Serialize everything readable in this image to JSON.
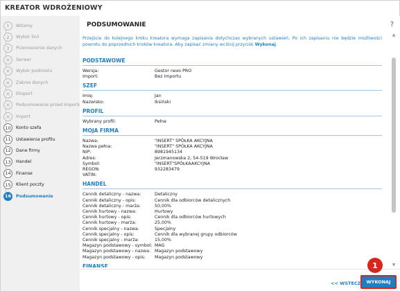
{
  "app": {
    "title": "KREATOR WDROŻENIOWY"
  },
  "steps": [
    {
      "num": "1",
      "label": "Witamy",
      "state": "done"
    },
    {
      "num": "2",
      "label": "Wybór linii",
      "state": "done"
    },
    {
      "num": "3",
      "label": "Przeniesienie danych",
      "state": "done"
    },
    {
      "num": "×",
      "label": "Serwer",
      "state": "skip"
    },
    {
      "num": "×",
      "label": "Wybór podmiotu",
      "state": "skip"
    },
    {
      "num": "×",
      "label": "Zakres danych",
      "state": "skip"
    },
    {
      "num": "×",
      "label": "Eksport",
      "state": "skip"
    },
    {
      "num": "×",
      "label": "Podsumowanie przed importem",
      "state": "skip"
    },
    {
      "num": "×",
      "label": "Import",
      "state": "skip"
    },
    {
      "num": "10",
      "label": "Konto szefa",
      "state": "todo"
    },
    {
      "num": "11",
      "label": "Ustawienia profilu",
      "state": "todo"
    },
    {
      "num": "12",
      "label": "Dane firmy",
      "state": "todo"
    },
    {
      "num": "13",
      "label": "Handel",
      "state": "todo"
    },
    {
      "num": "14",
      "label": "Finanse",
      "state": "todo"
    },
    {
      "num": "15",
      "label": "Klient poczty",
      "state": "todo"
    },
    {
      "num": "16",
      "label": "Podsumowanie",
      "state": "active"
    }
  ],
  "main": {
    "title": "PODSUMOWANIE",
    "help": "?",
    "info_pre": "Przejście do kolejnego kroku kreatora wymaga zapisania dotychczas wybranych ustawień. Po ich zapisaniu nie będzie możliwości powrotu do poprzednich kroków kreatora. Aby zapisać zmiany wciśnij przycisk ",
    "info_bold": "Wykonaj",
    "info_post": ".",
    "sections": [
      {
        "title": "PODSTAWOWE",
        "rows": [
          {
            "k": "Wersja:",
            "v": "Gestor nexo PRO"
          },
          {
            "k": "Import:",
            "v": "Bez importu"
          }
        ]
      },
      {
        "title": "SZEF",
        "rows": [
          {
            "k": "Imię:",
            "v": "Jan"
          },
          {
            "k": "Nazwisko:",
            "v": "Iksiński"
          }
        ]
      },
      {
        "title": "PROFIL",
        "rows": [
          {
            "k": "Wybrany profil:",
            "v": "Pełne"
          }
        ]
      },
      {
        "title": "MOJA FIRMA",
        "rows": [
          {
            "k": "Nazwa:",
            "v": "\"INSERT\" SPÓŁKA AKCYJNA"
          },
          {
            "k": "Nazwa pełna:",
            "v": "\"INSERT\" SPÓŁKA AKCYJNA"
          },
          {
            "k": "NIP:",
            "v": "8981945134"
          },
          {
            "k": "Adres:",
            "v": "Jerzmanowska 2, 54-519 Wrocław"
          },
          {
            "k": "Symbol:",
            "v": "\"INSERT\"SPÓŁKAAKCYJNA"
          },
          {
            "k": "REGON:",
            "v": "932283479"
          },
          {
            "k": "VATIN:",
            "v": ""
          }
        ]
      },
      {
        "title": "HANDEL",
        "rows": [
          {
            "k": "Cennik detaliczny - nazwa:",
            "v": "Detaliczny"
          },
          {
            "k": "Cennik detaliczny - opis:",
            "v": "Cennik dla odbiorców detalicznych"
          },
          {
            "k": "Cennik detaliczny - marża:",
            "v": "50,00%"
          },
          {
            "k": "Cennik hurtowy - nazwa:",
            "v": "Hurtowy"
          },
          {
            "k": "Cennik hurtowy - opis:",
            "v": "Cennik dla odbiorców hurtowych"
          },
          {
            "k": "Cennik hurtowy - marża:",
            "v": "25,00%"
          },
          {
            "k": "Cennik specjalny - nazwa:",
            "v": "Specjalny"
          },
          {
            "k": "Cennik specjalny - opis:",
            "v": "Cennik dla wybranej grupy odbiorców"
          },
          {
            "k": "Cennik specjalny - marża:",
            "v": "15,00%"
          },
          {
            "k": "Magazyn podstawowy - symbol:",
            "v": "MAG"
          },
          {
            "k": "Magazyn podstawowy - nazwa:",
            "v": "Magazyn podstawowy"
          },
          {
            "k": "Magazyn podstawowy - opis:",
            "v": "Magazyn podstawowy"
          }
        ]
      },
      {
        "title": "FINANSE",
        "rows": []
      }
    ]
  },
  "footer": {
    "back_label": "<< WSTECZ",
    "finish_label": "WYKONAJ"
  },
  "callout": {
    "label": "1"
  },
  "colors": {
    "accent": "#1f7ec3",
    "callout": "#d7261e"
  }
}
